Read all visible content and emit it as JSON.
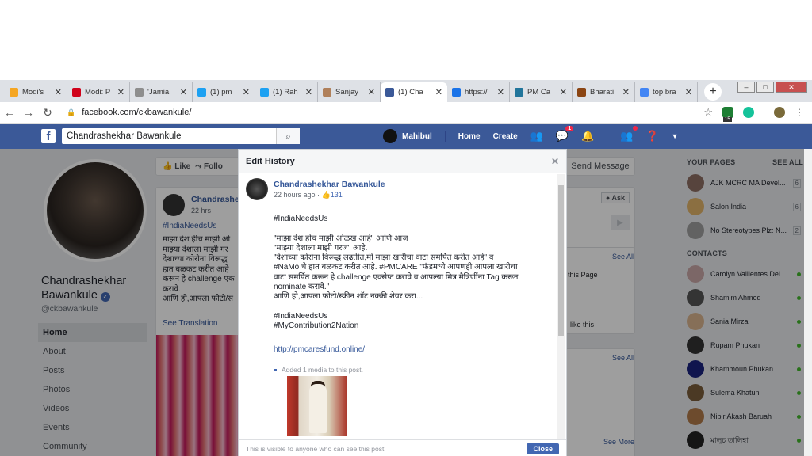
{
  "browser": {
    "tabs": [
      {
        "title": "Modi's",
        "favcolor": "#f5a623"
      },
      {
        "title": "Modi: P",
        "favcolor": "#d0021b"
      },
      {
        "title": "'Jamia",
        "favcolor": "#8e8e8e"
      },
      {
        "title": "(1) pm",
        "favcolor": "#1da1f2"
      },
      {
        "title": "(1) Rah",
        "favcolor": "#1da1f2"
      },
      {
        "title": "Sanjay",
        "favcolor": "#b0805a"
      },
      {
        "title": "(1) Cha",
        "favcolor": "#3b5998"
      },
      {
        "title": "https://",
        "favcolor": "#1a73e8"
      },
      {
        "title": "PM Ca",
        "favcolor": "#21759b"
      },
      {
        "title": "Bharati",
        "favcolor": "#8b4513"
      },
      {
        "title": "top bra",
        "favcolor": "#4285f4"
      }
    ],
    "active_tab_index": 6,
    "url": "facebook.com/ckbawankule/",
    "ext_badge": "15"
  },
  "fb": {
    "search_value": "Chandrashekhar Bawankule",
    "user": "Mahibul",
    "home": "Home",
    "create": "Create",
    "notif_badge": "1"
  },
  "profile": {
    "name": "Chandrashekhar Bawankule",
    "handle": "@ckbawankule",
    "nav": [
      "Home",
      "About",
      "Posts",
      "Photos",
      "Videos",
      "Events",
      "Community"
    ],
    "like": "Like",
    "follow": "Follo",
    "send_message": "Send Message",
    "ask": "Ask",
    "see_all": "See All",
    "see_more": "See More",
    "this_page": "this Page",
    "like_this": "like this",
    "see_translation": "See Translation",
    "bg_post_author": "Chandrashe",
    "bg_post_time": "22 hrs ·",
    "bg_post_tag": "#IndiaNeedsUs",
    "bg_post_lines": [
      "माझा देश हीच माझी ओ",
      "माझ्या देशाला माझी गर",
      "देशाच्या कोरोना विरूद्ध",
      "हात बळकट करीत आहे",
      "करून हे challenge एक",
      "करावे.",
      "आणि हो,आपला फोटो/स"
    ]
  },
  "right": {
    "your_pages": "YOUR PAGES",
    "see_all": "SEE ALL",
    "pages": [
      {
        "name": "AJK MCRC MA Devel...",
        "count": "6"
      },
      {
        "name": "Salon India",
        "count": "6"
      },
      {
        "name": "No Stereotypes Plz: N...",
        "count": "2"
      }
    ],
    "contacts": "CONTACTS",
    "people": [
      "Carolyn Vallientes Del...",
      "Shamim Ahmed",
      "Sania Mirza",
      "Rupam Phukan",
      "Khammoun Phukan",
      "Sulema Khatun",
      "Nibir Akash Baruah",
      "মালুচ তালিহা"
    ]
  },
  "modal": {
    "title": "Edit History",
    "author": "Chandrashekhar Bawankule",
    "time": "22 hours ago ·",
    "reactions": "131",
    "text": "#IndiaNeedsUs\n\n\"माझा देश हीच माझी ओळख आहे\" आणि आज\n\"माझ्या देशाला माझी गरज\" आहे.\n\"देशाच्या कोरोना विरूद्ध लढतीत,मी माझा खारीचा वाटा समर्पित करीत आहे\" व\n#NaMo चे हात बळकट करीत आहे. #PMCARE \"फंडमध्ये आपणही आपला खारीचा\nवाटा समर्पित करून हे challenge एक्सेप्ट करावे व आपल्या मित्र मैत्रिणींना Tag करून\nnominate करावे.\"\nआणि हो,आपला फोटो/स्क्रीन शॉट नक्की शेयर करा...\n\n#IndiaNeedsUs\n#MyContribution2Nation",
    "link": "http://pmcaresfund.online/",
    "media_note": "Added 1 media to this post.",
    "footer": "This is visible to anyone who can see this post.",
    "close": "Close"
  }
}
